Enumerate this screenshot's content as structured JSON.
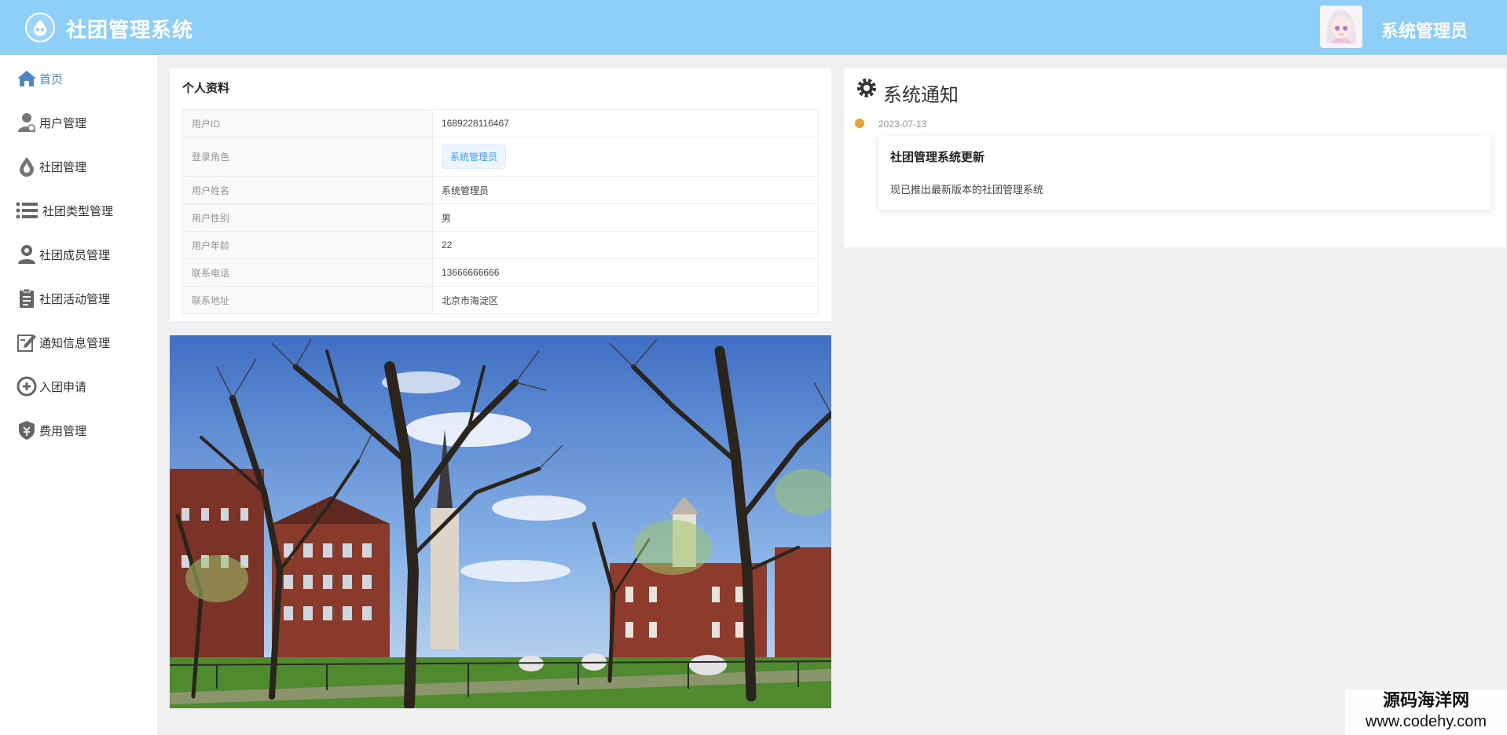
{
  "header": {
    "app_title": "社团管理系统",
    "user_name": "系统管理员",
    "logo_icon": "drop-logo-icon",
    "avatar_icon": "anime-avatar"
  },
  "sidebar": {
    "items": [
      {
        "label": "首页",
        "icon": "home-icon",
        "active": true
      },
      {
        "label": "用户管理",
        "icon": "user-icon"
      },
      {
        "label": "社团管理",
        "icon": "drop-icon"
      },
      {
        "label": "社团类型管理",
        "icon": "list-icon"
      },
      {
        "label": "社团成员管理",
        "icon": "member-icon"
      },
      {
        "label": "社团活动管理",
        "icon": "document-icon"
      },
      {
        "label": "通知信息管理",
        "icon": "edit-icon"
      },
      {
        "label": "入团申请",
        "icon": "add-circle-icon"
      },
      {
        "label": "费用管理",
        "icon": "money-shield-icon"
      }
    ]
  },
  "profile": {
    "title": "个人资料",
    "rows": [
      {
        "label": "用户ID",
        "value": "1689228116467"
      },
      {
        "label": "登录角色",
        "value": "系统管理员"
      },
      {
        "label": "用户姓名",
        "value": "系统管理员"
      },
      {
        "label": "用户性别",
        "value": "男"
      },
      {
        "label": "用户年龄",
        "value": "22"
      },
      {
        "label": "联系电话",
        "value": "13666666666"
      },
      {
        "label": "联系地址",
        "value": "北京市海淀区"
      }
    ]
  },
  "notice": {
    "title": "系统通知",
    "date": "2023-07-13",
    "item_title": "社团管理系统更新",
    "item_content": "现已推出最新版本的社团管理系统"
  },
  "watermark": {
    "cn": "源码海洋网",
    "url": "www.codehy.com"
  },
  "colors": {
    "header": "#8dcff7",
    "active": "#4a86c8",
    "dot": "#e6a23c"
  }
}
